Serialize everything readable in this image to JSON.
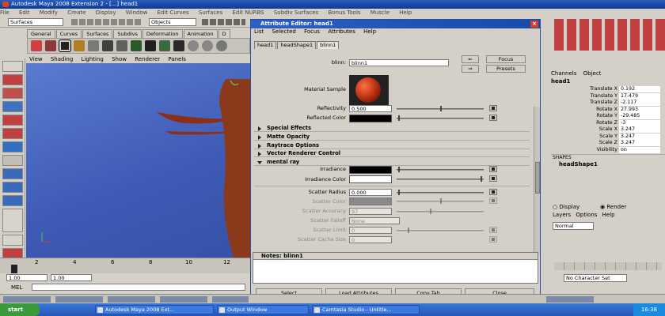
{
  "window": {
    "title": "Autodesk Maya 2008 Extension 2 - [...]  head1"
  },
  "menubar": [
    "File",
    "Edit",
    "Modify",
    "Create",
    "Display",
    "Window",
    "Edit Curves",
    "Surfaces",
    "Edit NURBS",
    "Subdiv Surfaces",
    "Bonus Tools",
    "Muscle",
    "Help"
  ],
  "toolbar": {
    "menu_set": "Surfaces",
    "selection_mode": "Objects"
  },
  "shelf_tabs": [
    "General",
    "Curves",
    "Surfaces",
    "Subdivs",
    "Deformation",
    "Animation",
    "D"
  ],
  "viewport_menu": [
    "View",
    "Shading",
    "Lighting",
    "Show",
    "Renderer",
    "Panels"
  ],
  "timeline": {
    "ticks": [
      "2",
      "4",
      "6",
      "8",
      "10",
      "12"
    ],
    "start": "1.00",
    "start2": "1.00",
    "mel_label": "MEL"
  },
  "attr_editor": {
    "title": "Attribute Editor: head1",
    "menu": [
      "List",
      "Selected",
      "Focus",
      "Attributes",
      "Help"
    ],
    "tabs": [
      "head1",
      "headShape1",
      "blinn1"
    ],
    "node_label": "blinn:",
    "node_name": "blinn1",
    "focus_btn": "Focus",
    "presets_btn": "Presets",
    "material_sample_label": "Material Sample",
    "reflectivity_label": "Reflectivity",
    "reflectivity_value": "0.500",
    "reflectivity_level": 0.5,
    "reflected_color_label": "Reflected Color",
    "sections": [
      "Special Effects",
      "Matte Opacity",
      "Raytrace Options",
      "Vector Renderer Control"
    ],
    "open_section": "mental ray",
    "irradiance_label": "Irradiance",
    "irradiance_color_label": "Irradiance Color",
    "scatter_radius_label": "Scatter Radius",
    "scatter_radius_value": "0.000",
    "scatter_color_label": "Scatter Color",
    "scatter_accuracy_label": "Scatter Accuracy",
    "scatter_accuracy_value": "97",
    "scatter_falloff_label": "Scatter Falloff",
    "scatter_falloff_value": "None",
    "scatter_limit_label": "Scatter Limit",
    "scatter_limit_value": "0",
    "scatter_cache_label": "Scatter Cache Size",
    "scatter_cache_value": "0",
    "notes_label": "Notes: blinn1",
    "buttons": [
      "Select",
      "Load Attributes",
      "Copy Tab",
      "Close"
    ]
  },
  "channel_box": {
    "tabs": [
      "Channels",
      "Object"
    ],
    "object": "head1",
    "rows": [
      {
        "name": "Translate X",
        "value": "0.192"
      },
      {
        "name": "Translate Y",
        "value": "17.479"
      },
      {
        "name": "Translate Z",
        "value": "-2.117"
      },
      {
        "name": "Rotate X",
        "value": "27.993"
      },
      {
        "name": "Rotate Y",
        "value": "-29.485"
      },
      {
        "name": "Rotate Z",
        "value": "-3"
      },
      {
        "name": "Scale X",
        "value": "3.247"
      },
      {
        "name": "Scale Y",
        "value": "3.247"
      },
      {
        "name": "Scale Z",
        "value": "3.247"
      },
      {
        "name": "Visibility",
        "value": "on"
      }
    ],
    "shapes_label": "SHAPES",
    "shape_name": "headShape1"
  },
  "layers": {
    "display": "Display",
    "render": "Render",
    "menu": [
      "Layers",
      "Options",
      "Help"
    ],
    "type": "Normal"
  },
  "anim": {
    "character": "No Character Set"
  },
  "taskbar": {
    "start": "start",
    "items": [
      "Autodesk Maya 2008 Ext...",
      "Output Window",
      "Camtasia Studio - Untitle..."
    ],
    "clock": "16:38"
  },
  "colors": {
    "viewport": "#4a68c4",
    "titlebar": "#1a4aa8",
    "accent": "#2d5fc4"
  }
}
